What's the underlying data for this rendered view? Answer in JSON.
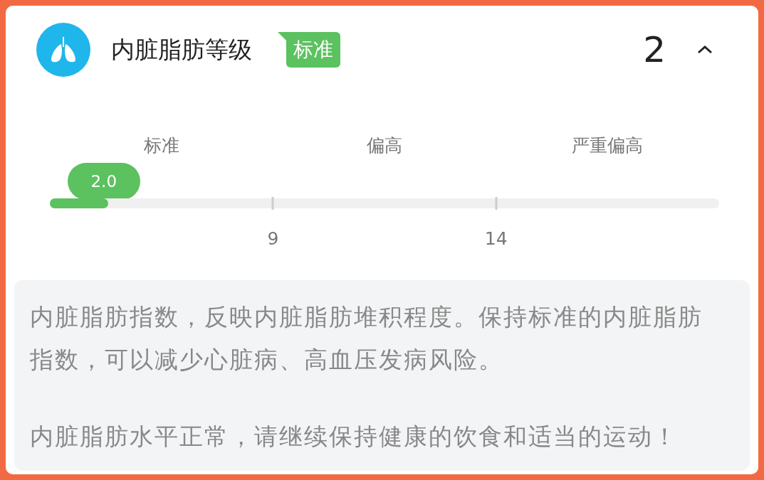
{
  "header": {
    "title": "内脏脂肪等级",
    "badge": "标准",
    "value": "2",
    "expanded": true
  },
  "scale": {
    "segments": [
      {
        "label": "标准"
      },
      {
        "label": "偏高"
      },
      {
        "label": "严重偏高"
      }
    ],
    "boundaries": [
      "9",
      "14"
    ],
    "value_label": "2.0",
    "level": 0.087
  },
  "description": {
    "paragraphs": [
      "内脏脂肪指数，反映内脏脂肪堆积程度。保持标准的内脏脂肪指数，可以减少心脏病、高血压发病风险。",
      "内脏脂肪水平正常，请继续保持健康的饮食和适当的运动！"
    ]
  }
}
